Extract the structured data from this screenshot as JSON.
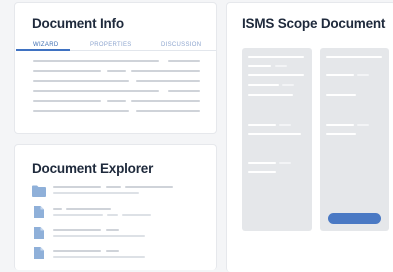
{
  "info": {
    "title": "Document Info",
    "tabs": [
      {
        "label": "WIZARD",
        "active": true
      },
      {
        "label": "PROPERTIES",
        "active": false
      },
      {
        "label": "DISCUSSION",
        "active": false
      }
    ]
  },
  "explorer": {
    "title": "Document Explorer",
    "items": [
      {
        "icon": "folder-icon"
      },
      {
        "icon": "file-icon"
      },
      {
        "icon": "file-icon"
      },
      {
        "icon": "file-icon"
      }
    ]
  },
  "scope": {
    "title": "ISMS Scope Document"
  },
  "colors": {
    "accent": "#3f72c2",
    "title": "#1f2a3c",
    "placeholder": "#cfd3d9",
    "panel": "#e5e7ea",
    "icon": "#8fb0d9"
  }
}
